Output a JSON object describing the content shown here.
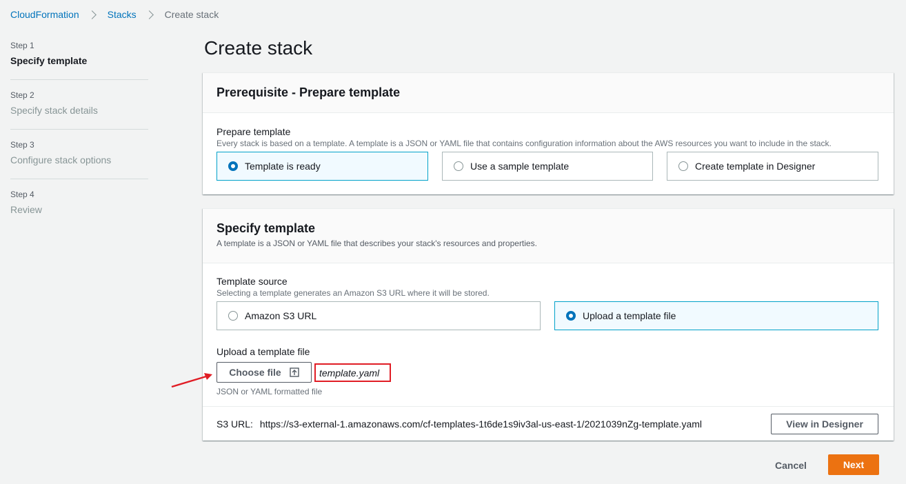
{
  "breadcrumb": {
    "root": "CloudFormation",
    "stacks": "Stacks",
    "current": "Create stack"
  },
  "steps": [
    {
      "num": "Step 1",
      "title": "Specify template",
      "active": true
    },
    {
      "num": "Step 2",
      "title": "Specify stack details",
      "active": false
    },
    {
      "num": "Step 3",
      "title": "Configure stack options",
      "active": false
    },
    {
      "num": "Step 4",
      "title": "Review",
      "active": false
    }
  ],
  "page_title": "Create stack",
  "prerequisite": {
    "title": "Prerequisite - Prepare template",
    "label": "Prepare template",
    "description": "Every stack is based on a template. A template is a JSON or YAML file that contains configuration information about the AWS resources you want to include in the stack.",
    "options": [
      {
        "label": "Template is ready",
        "selected": true
      },
      {
        "label": "Use a sample template",
        "selected": false
      },
      {
        "label": "Create template in Designer",
        "selected": false
      }
    ]
  },
  "specify_template": {
    "title": "Specify template",
    "description": "A template is a JSON or YAML file that describes your stack's resources and properties.",
    "source_label": "Template source",
    "source_description": "Selecting a template generates an Amazon S3 URL where it will be stored.",
    "source_options": [
      {
        "label": "Amazon S3 URL",
        "selected": false
      },
      {
        "label": "Upload a template file",
        "selected": true
      }
    ],
    "upload_label": "Upload a template file",
    "choose_file_label": "Choose file",
    "file_name": "template.yaml",
    "file_hint": "JSON or YAML formatted file",
    "s3_url_label": "S3 URL:",
    "s3_url_value": "https://s3-external-1.amazonaws.com/cf-templates-1t6de1s9iv3al-us-east-1/2021039nZg-template.yaml",
    "view_designer_label": "View in Designer"
  },
  "footer": {
    "cancel_label": "Cancel",
    "next_label": "Next"
  },
  "colors": {
    "link": "#0073bb",
    "primary_button": "#ec7211",
    "selected_tile_bg": "#f1faff",
    "selected_tile_border": "#00a1c9",
    "highlight": "#e01c24"
  }
}
